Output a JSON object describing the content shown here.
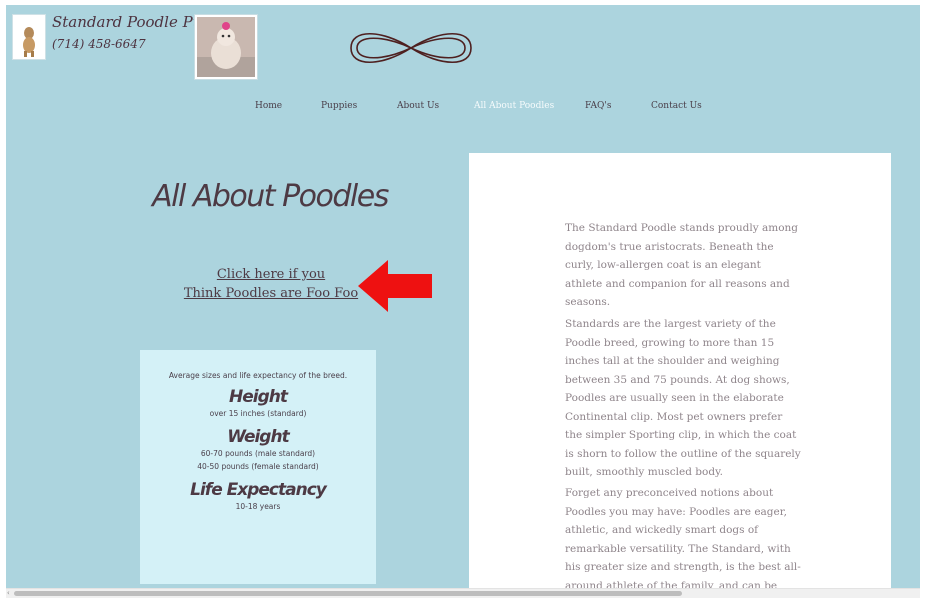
{
  "brand": {
    "name": "Standard Poodle Pups",
    "phone": "(714) 458-6647"
  },
  "nav": {
    "items": [
      {
        "label": "Home",
        "active": false
      },
      {
        "label": "Puppies",
        "active": false
      },
      {
        "label": "About Us",
        "active": false
      },
      {
        "label": "All About Poodles",
        "active": true
      },
      {
        "label": "FAQ's",
        "active": false
      },
      {
        "label": "Contact Us",
        "active": false
      }
    ]
  },
  "main": {
    "title": "All About Poodles",
    "link_line1": "Click here if you",
    "link_line2": "Think Poodles are Foo Foo"
  },
  "info_box": {
    "intro": "Average sizes and life expectancy of the breed.",
    "height_heading": "Height",
    "height_value": "over 15 inches (standard)",
    "weight_heading": "Weight",
    "weight_value1": "60-70 pounds (male standard)",
    "weight_value2": "40-50 pounds (female standard)",
    "life_heading": "Life Expectancy",
    "life_value": "10-18 years"
  },
  "article": {
    "p1": "The Standard Poodle stands proudly among dogdom's true aristocrats. Beneath the curly, low-allergen coat is an elegant athlete and companion for all reasons and seasons.",
    "p2": "Standards are the largest variety of the Poodle breed, growing to more than 15 inches tall at the shoulder and weighing between 35 and 75 pounds. At dog shows, Poodles are usually seen in the elaborate Continental clip. Most pet owners prefer the simpler Sporting clip, in which the coat is shorn to follow the outline of the squarely built, smoothly muscled body.",
    "p3": "Forget any preconceived notions about Poodles you may have: Poodles are eager, athletic, and wickedly smart dogs of remarkable versatility. The Standard, with his greater size and strength, is the best all-around athlete of the family, and can be trained with great success."
  },
  "colors": {
    "background": "#acd4de",
    "arrow": "#ee1111",
    "info_box": "#d4f1f7",
    "text_dark": "#4d3a44"
  },
  "icons": {
    "logo": "infinity-knot-icon",
    "arrow": "left-arrow-icon"
  }
}
